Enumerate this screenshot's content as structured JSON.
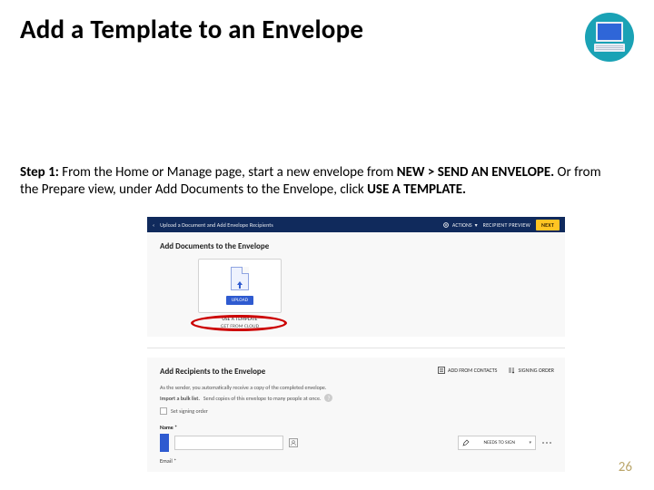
{
  "title": "Add a Template to an Envelope",
  "step": {
    "label": "Step 1:",
    "body_plain": "  From the Home or Manage page, start a new envelope from ",
    "path1": "NEW > SEND AN ENVELOPE.",
    "body_mid": " Or from the Prepare view, under Add Documents to the Envelope, click ",
    "path2": "USE A TEMPLATE."
  },
  "screenshot": {
    "topbar": {
      "back_glyph": "‹",
      "breadcrumb": "Upload a Document and Add Envelope Recipients",
      "actions_label": "ACTIONS",
      "actions_caret": "▾",
      "recipient_preview": "RECIPIENT PREVIEW",
      "next": "NEXT"
    },
    "add_documents": {
      "heading": "Add Documents to the Envelope",
      "upload_button": "UPLOAD",
      "use_template": "USE A TEMPLATE",
      "get_from_cloud": "GET FROM CLOUD"
    },
    "add_recipients": {
      "heading": "Add Recipients to the Envelope",
      "sub1": "As the sender, you automatically receive a copy of the completed envelope.",
      "bulk_label": "Import a bulk list.",
      "bulk_hint": "Send copies of this envelope to many people at once.",
      "tools": {
        "add_from_contacts": "ADD FROM CONTACTS",
        "signing_order": "SIGNING ORDER"
      },
      "set_signing_order": "Set signing order",
      "name_label": "Name *",
      "role_value": "NEEDS TO SIGN",
      "email_label": "Email *"
    }
  },
  "page_number": "26"
}
